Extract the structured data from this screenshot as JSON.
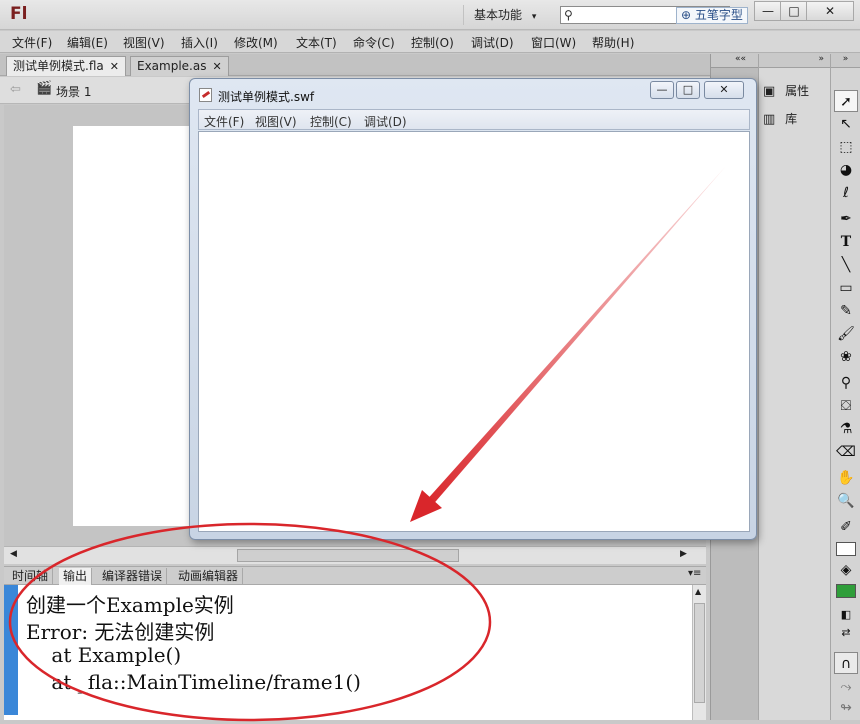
{
  "app": {
    "logo": "Fl",
    "workspace": "基本功能",
    "ime_label": "五笔字型"
  },
  "menubar": {
    "items": [
      "文件(F)",
      "编辑(E)",
      "视图(V)",
      "插入(I)",
      "修改(M)",
      "文本(T)",
      "命令(C)",
      "控制(O)",
      "调试(D)",
      "窗口(W)",
      "帮助(H)"
    ]
  },
  "doc_tabs": [
    {
      "label": "测试单例模式.fla",
      "active": true
    },
    {
      "label": "Example.as",
      "active": false
    }
  ],
  "scene": {
    "label": "场景 1"
  },
  "right_panel": {
    "properties_label": "属性",
    "library_label": "库"
  },
  "output_tabs": [
    "时间轴",
    "输出",
    "编译器错误",
    "动画编辑器"
  ],
  "output_lines": [
    "创建一个Example实例",
    "Error: 无法创建实例",
    "    at Example()",
    "    at _fla::MainTimeline/frame1()"
  ],
  "swf_window": {
    "title": "测试单例模式.swf",
    "menu": [
      "文件(F)",
      "视图(V)",
      "控制(C)",
      "调试(D)"
    ]
  },
  "colors": {
    "annotation_red": "#d9262b",
    "output_marker": "#3a87d8",
    "fill_swatch": "#2f9e3a"
  },
  "icons": [
    "search-icon",
    "minimize-icon",
    "maximize-icon",
    "close-icon",
    "back-arrow-icon",
    "scene-clapper-icon",
    "properties-icon",
    "library-icon",
    "selection-tool-icon",
    "subselection-tool-icon",
    "text-tool-icon",
    "line-tool-icon",
    "rectangle-tool-icon",
    "pencil-tool-icon",
    "brush-tool-icon",
    "bone-tool-icon",
    "paint-bucket-icon",
    "eyedropper-icon",
    "eraser-icon",
    "hand-tool-icon",
    "zoom-tool-icon"
  ]
}
